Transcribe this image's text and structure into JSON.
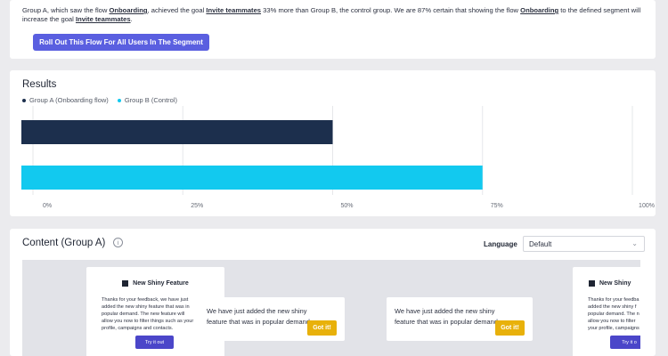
{
  "summary": {
    "t1": "Group A, which saw the flow ",
    "flow": "Onboarding",
    "t2": ", achieved the goal ",
    "goal": "Invite teammates",
    "t3": " 33% more than Group B, the control group. We are 87% certain that showing the flow ",
    "flow2": "Onboarding",
    "t4": " to the defined segment will increase the goal ",
    "goal2": "Invite teammates",
    "t5": "."
  },
  "rollout_button": "Roll Out This Flow For All Users In The Segment",
  "results": {
    "title": "Results",
    "legend": [
      {
        "label": "Group A (Onboarding flow)",
        "color": "#1c2f4d"
      },
      {
        "label": "Group B (Control)",
        "color": "#12c9ef"
      }
    ]
  },
  "chart_data": {
    "type": "bar",
    "orientation": "horizontal",
    "categories": [
      "Group A (Onboarding flow)",
      "Group B (Control)"
    ],
    "values": [
      50,
      75
    ],
    "colors": [
      "#1c2f4d",
      "#12c9ef"
    ],
    "xlim": [
      0,
      100
    ],
    "x_ticks": [
      "0%",
      "25%",
      "50%",
      "75%",
      "100%"
    ],
    "x_tick_values": [
      0,
      25,
      50,
      75,
      100
    ],
    "grid": true,
    "legend": "top-left"
  },
  "content": {
    "title": "Content (Group A)",
    "info_icon": "i",
    "language_label": "Language",
    "language_value": "Default",
    "chevron": "⌄",
    "popup": {
      "title": "New Shiny Feature",
      "body": "Thanks for your feedback, we have just added the new shiny feature that was in popular demand. The new feature will allow you now to filter things such as your profile, campaigns and contacts.",
      "button": "Try it out",
      "title_cut": "New Shiny",
      "body_cut": "Thanks for your feedba added the new shiny f popular demand. The n allow you now to filter your profile, campaigns",
      "button_cut": "Try it o"
    },
    "banner": {
      "text": "We have just added the new shiny feature that was in popular demand.",
      "button": "Got it!"
    }
  }
}
